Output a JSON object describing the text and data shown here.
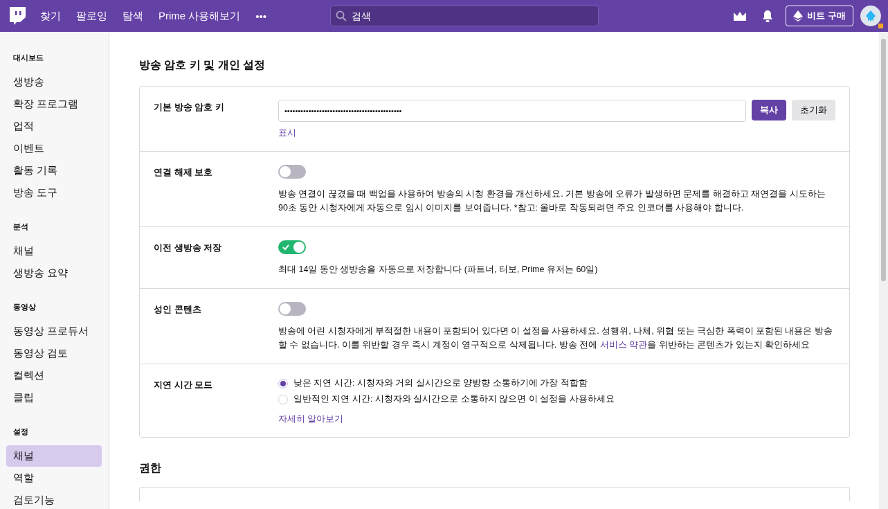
{
  "topbar": {
    "nav": [
      {
        "label": "찾기"
      },
      {
        "label": "팔로잉"
      },
      {
        "label": "탐색"
      },
      {
        "label": "Prime 사용해보기"
      },
      {
        "label": "•••"
      }
    ],
    "search": {
      "placeholder": "검색"
    },
    "bits_button": "비트 구매",
    "avatar": {
      "notification": true
    }
  },
  "sidebar": [
    {
      "heading": "대시보드",
      "items": [
        {
          "label": "생방송",
          "selected": false
        },
        {
          "label": "확장 프로그램",
          "selected": false
        },
        {
          "label": "업적",
          "selected": false
        },
        {
          "label": "이벤트",
          "selected": false
        },
        {
          "label": "활동 기록",
          "selected": false
        },
        {
          "label": "방송 도구",
          "selected": false
        }
      ]
    },
    {
      "heading": "분석",
      "items": [
        {
          "label": "채널",
          "selected": false
        },
        {
          "label": "생방송 요약",
          "selected": false
        }
      ]
    },
    {
      "heading": "동영상",
      "items": [
        {
          "label": "동영상 프로듀서",
          "selected": false
        },
        {
          "label": "동영상 검토",
          "selected": false
        },
        {
          "label": "컬렉션",
          "selected": false
        },
        {
          "label": "클립",
          "selected": false
        }
      ]
    },
    {
      "heading": "설정",
      "items": [
        {
          "label": "채널",
          "selected": true
        },
        {
          "label": "역할",
          "selected": false
        },
        {
          "label": "검토기능",
          "selected": false
        }
      ]
    }
  ],
  "section_title": "방송 암호 키 및 개인 설정",
  "rows": [
    {
      "kind": "key",
      "label": "기본 방송 암호 키",
      "value": "••••••••••••••••••••••••••••••••••••••••••••",
      "copy": "복사",
      "reset": "초기화",
      "show_link": "표시"
    },
    {
      "kind": "toggle",
      "label": "연결 해제 보호",
      "on": false,
      "description": "방송 연결이 끊겼을 때 백업을 사용하여 방송의 시청 환경을 개선하세요. 기본 방송에 오류가 발생하면 문제를 해결하고 재연결을 시도하는 90초 동안 시청자에게 자동으로 임시 이미지를 보여줍니다. *참고: 올바로 작동되려면 주요 인코더를 사용해야 합니다."
    },
    {
      "kind": "toggle",
      "label": "이전 생방송 저장",
      "on": true,
      "description": "최대 14일 동안 생방송을 자동으로 저장합니다 (파트너, 터보, Prime 유저는 60일)"
    },
    {
      "kind": "toggle",
      "label": "성인 콘텐츠",
      "on": false,
      "description": "방송에 어린 시청자에게 부적절한 내용이 포함되어 있다면 이 설정을 사용하세요. 성행위, 나체, 위협 또는 극심한 폭력이 포함된 내용은 방송할 수 없습니다. 이를 위반할 경우 즉시 계정이 영구적으로 삭제됩니다. 방송 전에 ",
      "terms_link": "서비스 약관",
      "description_end": "을 위반하는 콘텐츠가 있는지 확인하세요"
    },
    {
      "kind": "radio",
      "label": "지연 시간 모드",
      "options": [
        {
          "label": "낮은 지연 시간: 시청자와 거의 실시간으로 양방향 소통하기에 가장 적합함",
          "selected": true
        },
        {
          "label": "일반적인 지연 시간: 시청자와 실시간으로 소통하지 않으면 이 설정을 사용하세요",
          "selected": false
        }
      ],
      "link": "자세히 알아보기"
    }
  ],
  "next_section_title": "권한"
}
